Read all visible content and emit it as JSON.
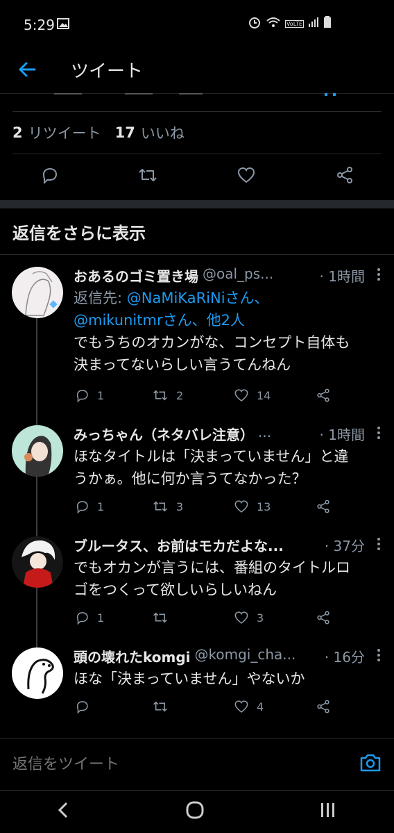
{
  "status_bar": {
    "time": "5:29",
    "volte": "VoLTE"
  },
  "header": {
    "title": "ツイート"
  },
  "stats": {
    "retweets_count": "2",
    "retweets_label": "リツイート",
    "likes_count": "17",
    "likes_label": "いいね"
  },
  "more_replies_label": "返信をさらに表示",
  "tweets": [
    {
      "name": "おあるのゴミ置き場",
      "handle": "@oal_ps...",
      "time": "· 1時間",
      "reply_prefix": "返信先: ",
      "reply_mentions_1": "@NaMiKaRiNiさん、",
      "reply_mentions_2": "@mikunitmrさん、他2人",
      "text_line1": "でもうちのオカンがな、コンセプト自体も",
      "text_line2": "決まってないらしい言うてんねん",
      "replies": "1",
      "retweets": "2",
      "likes": "14"
    },
    {
      "name": "みっちゃん（ネタバレ注意）",
      "handle": "...",
      "time": "· 1時間",
      "text_line1": "ほなタイトルは「決まっていません」と違",
      "text_line2": "うかぁ。他に何か言うてなかった？",
      "replies": "1",
      "retweets": "3",
      "likes": "13"
    },
    {
      "name": "ブルータス、お前はモカだよな...",
      "handle": "",
      "time": "· 37分",
      "text_line1": "でもオカンが言うには、番組のタイトルロ",
      "text_line2": "ゴをつくって欲しいらしいねん",
      "replies": "1",
      "retweets": "",
      "likes": "3"
    },
    {
      "name": "頭の壊れたkomgi",
      "handle": "@komgi_cha...",
      "time": "· 16分",
      "text_line1": "ほな「決まっていません」やないか",
      "replies": "",
      "retweets": "",
      "likes": "4"
    }
  ],
  "compose": {
    "placeholder": "返信をツイート"
  },
  "colors": {
    "accent": "#1d9bf0",
    "background": "#000000",
    "muted": "#8b98a5",
    "text": "#e7e7e7"
  }
}
